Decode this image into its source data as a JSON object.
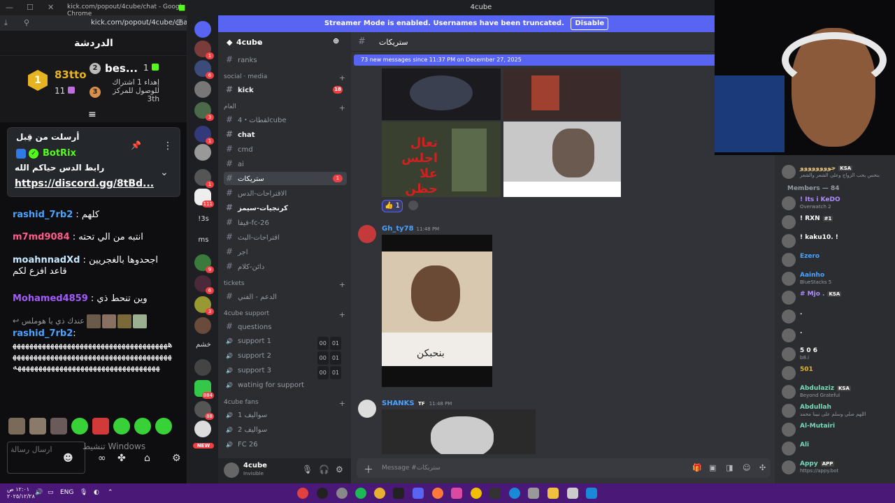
{
  "browser": {
    "title": "kick.com/popout/4cube/chat - Google Chrome",
    "url": "kick.com/popout/4cube/chat"
  },
  "kick": {
    "header": "الدردشة",
    "leaderboard": {
      "first_name": "83tto",
      "first_count": "11",
      "second_name": "bes...",
      "second_count": "1",
      "third_text": "إهداء 1 اشتراك للوصول للمركز 3th"
    },
    "pinned": {
      "header": "أرسلت من قِبل",
      "bot_name": "BotRix",
      "line1": "رابط الدس حياكم الله",
      "link": "https://discord.gg/8tBd..."
    },
    "messages": [
      {
        "user": "rashid_7rb2",
        "text": "كلهم"
      },
      {
        "user": "m7md9084",
        "text": "انتبه من الي تحته"
      },
      {
        "user": "moahnnadXd",
        "text": "اجحدوها بالغجريين قاعد افزع لكم"
      },
      {
        "user": "Mohamed4859",
        "text": "وين تنحط ذي"
      },
      {
        "user": "",
        "text": "عندك ذي يا هوملس"
      },
      {
        "user": "rashid_7rb2",
        "text": "ههههههههههههههههههههههههههههههههههههههههههههههههههههههههههههههههههههههههههههههههههههههههههههههههههههههههههههههه"
      }
    ],
    "input_placeholder": "ارسال رسالة",
    "watermark": "تنشيط Windows"
  },
  "discord": {
    "title": "4cube",
    "streamer_banner": "Streamer Mode is enabled. Usernames have been truncated.",
    "disable_label": "Disable",
    "server_name": "4cube",
    "channels": [
      {
        "name": "ranks",
        "type": "text"
      },
      {
        "cat": "social · media"
      },
      {
        "name": "kick",
        "type": "text",
        "badge": "18",
        "unread": true
      },
      {
        "cat": "العام"
      },
      {
        "name": "لقطات・4cube",
        "type": "text"
      },
      {
        "name": "chat",
        "type": "text",
        "unread": true
      },
      {
        "name": "cmd",
        "type": "text"
      },
      {
        "name": "ai",
        "type": "text"
      },
      {
        "name": "ستريكات",
        "type": "text",
        "badge": "1",
        "active": true
      },
      {
        "name": "الاقتراحات-الدس",
        "type": "text"
      },
      {
        "name": "كرنجيات-سيمز",
        "type": "text",
        "unread": true
      },
      {
        "name": "فيفا-fc-26",
        "type": "text"
      },
      {
        "name": "اقتراحات-البث",
        "type": "text"
      },
      {
        "name": "اجر",
        "type": "text"
      },
      {
        "name": "دائن-كلام",
        "type": "text"
      },
      {
        "cat": "tickets"
      },
      {
        "name": "الدعم - الفني",
        "type": "text"
      },
      {
        "cat": "4cube support"
      },
      {
        "name": "questions",
        "type": "text"
      },
      {
        "name": "support 1",
        "type": "voice",
        "count": "00",
        "max": "01"
      },
      {
        "name": "support 2",
        "type": "voice",
        "count": "00",
        "max": "01"
      },
      {
        "name": "support 3",
        "type": "voice",
        "count": "00",
        "max": "01"
      },
      {
        "name": "watinig for support",
        "type": "voice"
      },
      {
        "cat": "4cube fans"
      },
      {
        "name": "سواليف 1",
        "type": "voice"
      },
      {
        "name": "سواليف 2",
        "type": "voice"
      },
      {
        "name": "FC 26",
        "type": "voice"
      }
    ],
    "channel_header": "ستريكات",
    "new_messages": "73 new messages since 11:37 PM on December 27, 2025",
    "reaction_count": "1",
    "msg1_author": "Gh_ty78",
    "msg1_time": "11:48 PM",
    "msg1_caption": "بنحبكن",
    "msg2_author": "SHANKS",
    "msg2_tag": "TF",
    "msg2_time": "11:48 PM",
    "image_text": "تعال اجلس علا حظن",
    "composer_placeholder": "Message #ستريكات",
    "user_name": "4cube",
    "user_status": "Invisible",
    "guild_labels": [
      "!3s",
      "ms",
      "خشم",
      "NEW"
    ],
    "guild_badges": [
      "1",
      "6",
      "3",
      "1",
      "1",
      "111",
      "9",
      "6",
      "3",
      "884",
      "88"
    ]
  },
  "members": {
    "header": "Members — 84",
    "list": [
      {
        "name": "جوووووووو",
        "tag": "KSA",
        "status": "بنحس بحب الزواج وعلى الشعر والشعر",
        "color": "#e6c07b"
      },
      {
        "name": "! Its i KeDO",
        "status": "Overwatch 2",
        "color": "#b08cff"
      },
      {
        "name": "! RXN",
        "tag": "#1",
        "status": "",
        "color": "#ffffff"
      },
      {
        "name": "! kaku10. !",
        "status": "",
        "color": "#ffffff"
      },
      {
        "name": "Ezero",
        "status": "",
        "color": "#4aa3ff"
      },
      {
        "name": "Aainho",
        "status": "BlueStacks 5",
        "color": "#4aa3ff"
      },
      {
        "name": "# Mjo .",
        "tag": "KSA",
        "status": "",
        "color": "#b08cff"
      },
      {
        "name": ".",
        "status": "",
        "color": "#ffffff"
      },
      {
        "name": ".",
        "status": "",
        "color": "#ffffff"
      },
      {
        "name": "5 0 6",
        "status": "b8.i",
        "color": "#ffffff"
      },
      {
        "name": "501",
        "status": "",
        "color": "#e6b422"
      },
      {
        "name": "Abdulaziz",
        "tag": "KSA",
        "status": "Beyond Grateful",
        "color": "#7ad8b8"
      },
      {
        "name": "Abdullah",
        "status": "اللهم صلي وسلم على نبينا محمد",
        "color": "#7ad8b8"
      },
      {
        "name": "Al-Mutairi",
        "status": "",
        "color": "#7ad8b8"
      },
      {
        "name": "Ali",
        "status": "",
        "color": "#7ad8b8"
      },
      {
        "name": "Appy",
        "tag": "APP",
        "status": "https://appy.bot",
        "color": "#7ad8b8"
      }
    ]
  },
  "taskbar": {
    "time": "١٢:٠١ ص",
    "date": "٢٠٢٥/١٢/٢٨",
    "lang": "ENG"
  }
}
